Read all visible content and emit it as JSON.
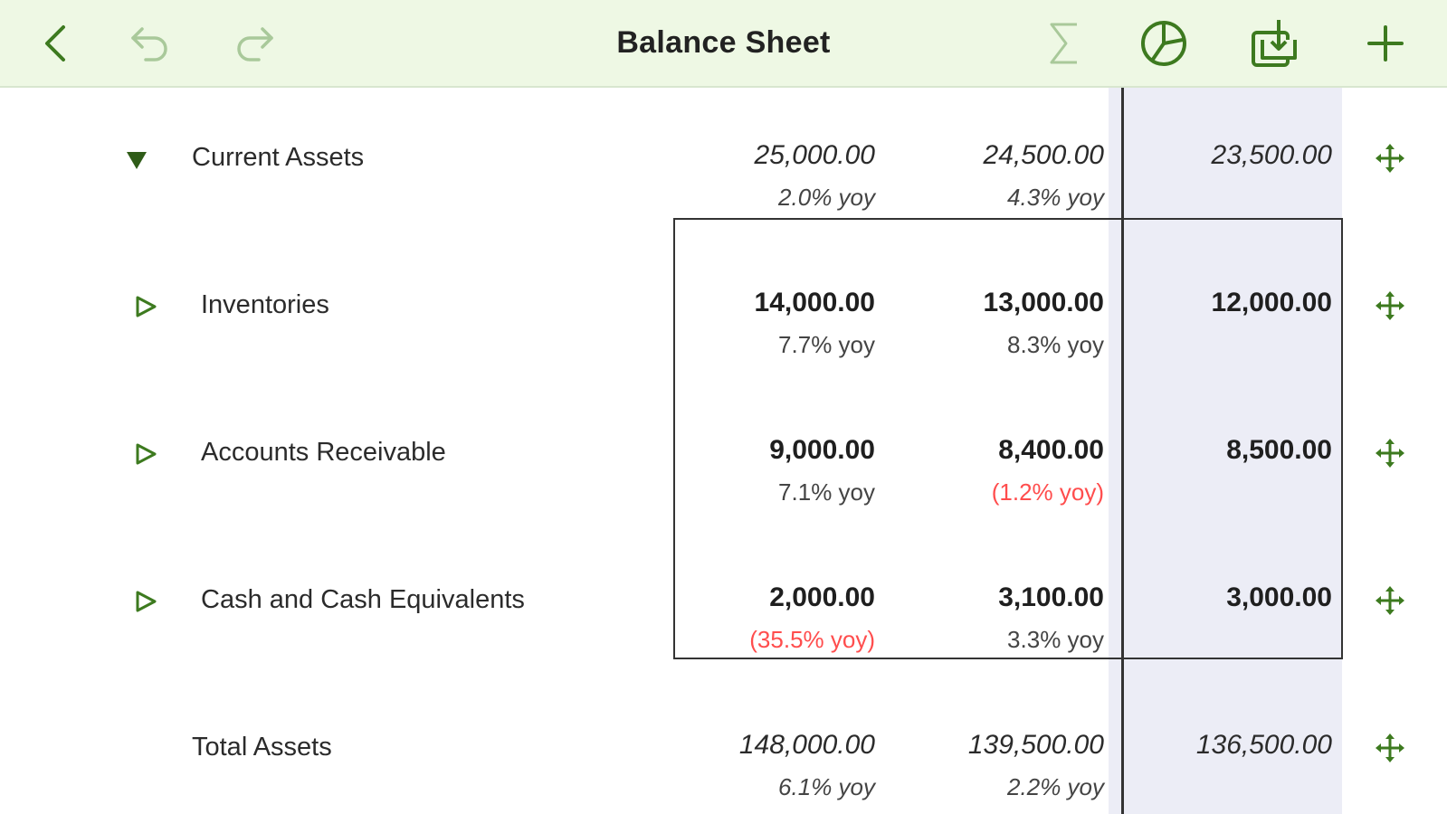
{
  "toolbar": {
    "title": "Balance Sheet",
    "icons": [
      "back-icon",
      "undo-icon",
      "redo-icon",
      "sigma-icon",
      "chart-icon",
      "download-icon",
      "add-icon"
    ],
    "accent_color": "#3d7a1f",
    "background_color": "#eef8e4"
  },
  "rows": [
    {
      "label": "Current Assets",
      "expanded": true,
      "cells": [
        {
          "value": "25,000.00",
          "yoy": "2.0% yoy"
        },
        {
          "value": "24,500.00",
          "yoy": "4.3% yoy"
        },
        {
          "value": "23,500.00",
          "yoy": ""
        }
      ]
    },
    {
      "label": "Inventories",
      "expanded": false,
      "cells": [
        {
          "value": "14,000.00",
          "yoy": "7.7% yoy"
        },
        {
          "value": "13,000.00",
          "yoy": "8.3% yoy"
        },
        {
          "value": "12,000.00",
          "yoy": ""
        }
      ]
    },
    {
      "label": "Accounts Receivable",
      "expanded": false,
      "cells": [
        {
          "value": "9,000.00",
          "yoy": "7.1% yoy"
        },
        {
          "value": "8,400.00",
          "yoy": "(1.2% yoy)"
        },
        {
          "value": "8,500.00",
          "yoy": ""
        }
      ]
    },
    {
      "label": "Cash and Cash Equivalents",
      "expanded": false,
      "cells": [
        {
          "value": "2,000.00",
          "yoy": "(35.5% yoy)"
        },
        {
          "value": "3,100.00",
          "yoy": "3.3% yoy"
        },
        {
          "value": "3,000.00",
          "yoy": ""
        }
      ]
    },
    {
      "label": "Total Assets",
      "cells": [
        {
          "value": "148,000.00",
          "yoy": "6.1% yoy"
        },
        {
          "value": "139,500.00",
          "yoy": "2.2% yoy"
        },
        {
          "value": "136,500.00",
          "yoy": ""
        }
      ]
    }
  ],
  "colors": {
    "negative": "#ff4d4d",
    "highlight_column": "#ecedf6"
  }
}
